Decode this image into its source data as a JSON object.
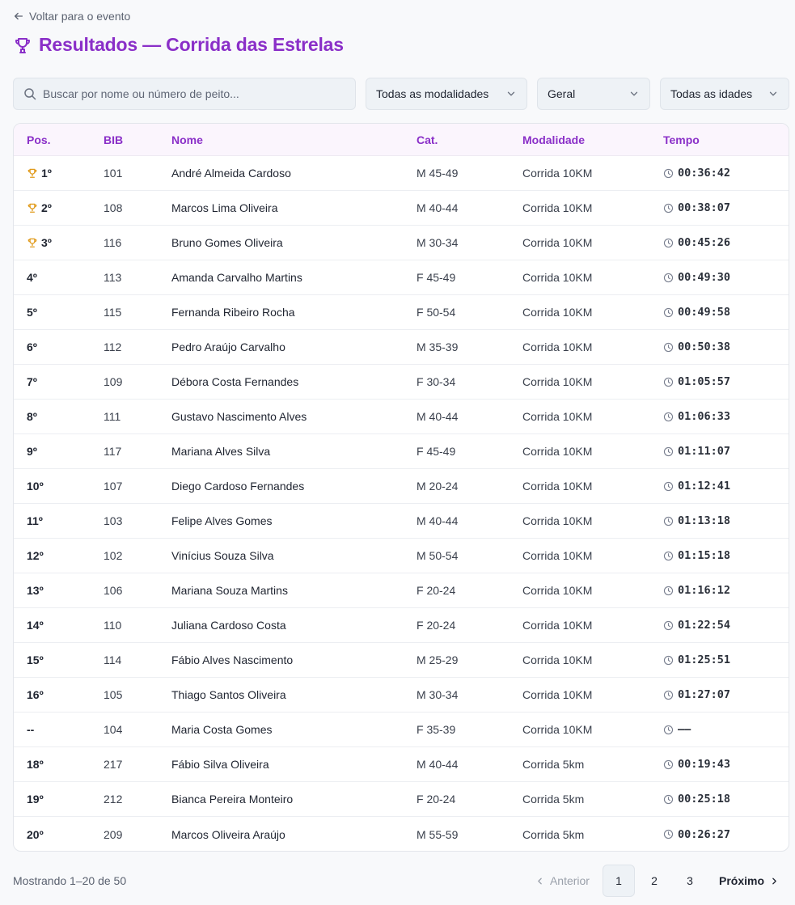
{
  "back_link": "Voltar para o evento",
  "title": "Resultados — Corrida das Estrelas",
  "accent_color": "#8a2fc8",
  "trophy_color": "#e09a1a",
  "search": {
    "placeholder": "Buscar por nome ou número de peito..."
  },
  "filters": {
    "modality": "Todas as modalidades",
    "gender": "Geral",
    "age": "Todas as idades"
  },
  "table": {
    "headers": {
      "pos": "Pos.",
      "bib": "BIB",
      "name": "Nome",
      "cat": "Cat.",
      "mod": "Modalidade",
      "time": "Tempo"
    },
    "rows": [
      {
        "pos": "1º",
        "trophy": true,
        "bib": "101",
        "name": "André Almeida Cardoso",
        "cat": "M 45-49",
        "mod": "Corrida 10KM",
        "time": "00:36:42"
      },
      {
        "pos": "2º",
        "trophy": true,
        "bib": "108",
        "name": "Marcos Lima Oliveira",
        "cat": "M 40-44",
        "mod": "Corrida 10KM",
        "time": "00:38:07"
      },
      {
        "pos": "3º",
        "trophy": true,
        "bib": "116",
        "name": "Bruno Gomes Oliveira",
        "cat": "M 30-34",
        "mod": "Corrida 10KM",
        "time": "00:45:26"
      },
      {
        "pos": "4º",
        "trophy": false,
        "bib": "113",
        "name": "Amanda Carvalho Martins",
        "cat": "F 45-49",
        "mod": "Corrida 10KM",
        "time": "00:49:30"
      },
      {
        "pos": "5º",
        "trophy": false,
        "bib": "115",
        "name": "Fernanda Ribeiro Rocha",
        "cat": "F 50-54",
        "mod": "Corrida 10KM",
        "time": "00:49:58"
      },
      {
        "pos": "6º",
        "trophy": false,
        "bib": "112",
        "name": "Pedro Araújo Carvalho",
        "cat": "M 35-39",
        "mod": "Corrida 10KM",
        "time": "00:50:38"
      },
      {
        "pos": "7º",
        "trophy": false,
        "bib": "109",
        "name": "Débora Costa Fernandes",
        "cat": "F 30-34",
        "mod": "Corrida 10KM",
        "time": "01:05:57"
      },
      {
        "pos": "8º",
        "trophy": false,
        "bib": "111",
        "name": "Gustavo Nascimento Alves",
        "cat": "M 40-44",
        "mod": "Corrida 10KM",
        "time": "01:06:33"
      },
      {
        "pos": "9º",
        "trophy": false,
        "bib": "117",
        "name": "Mariana Alves Silva",
        "cat": "F 45-49",
        "mod": "Corrida 10KM",
        "time": "01:11:07"
      },
      {
        "pos": "10º",
        "trophy": false,
        "bib": "107",
        "name": "Diego Cardoso Fernandes",
        "cat": "M 20-24",
        "mod": "Corrida 10KM",
        "time": "01:12:41"
      },
      {
        "pos": "11º",
        "trophy": false,
        "bib": "103",
        "name": "Felipe Alves Gomes",
        "cat": "M 40-44",
        "mod": "Corrida 10KM",
        "time": "01:13:18"
      },
      {
        "pos": "12º",
        "trophy": false,
        "bib": "102",
        "name": "Vinícius Souza Silva",
        "cat": "M 50-54",
        "mod": "Corrida 10KM",
        "time": "01:15:18"
      },
      {
        "pos": "13º",
        "trophy": false,
        "bib": "106",
        "name": "Mariana Souza Martins",
        "cat": "F 20-24",
        "mod": "Corrida 10KM",
        "time": "01:16:12"
      },
      {
        "pos": "14º",
        "trophy": false,
        "bib": "110",
        "name": "Juliana Cardoso Costa",
        "cat": "F 20-24",
        "mod": "Corrida 10KM",
        "time": "01:22:54"
      },
      {
        "pos": "15º",
        "trophy": false,
        "bib": "114",
        "name": "Fábio Alves Nascimento",
        "cat": "M 25-29",
        "mod": "Corrida 10KM",
        "time": "01:25:51"
      },
      {
        "pos": "16º",
        "trophy": false,
        "bib": "105",
        "name": "Thiago Santos Oliveira",
        "cat": "M 30-34",
        "mod": "Corrida 10KM",
        "time": "01:27:07"
      },
      {
        "pos": "--",
        "trophy": false,
        "bib": "104",
        "name": "Maria Costa Gomes",
        "cat": "F 35-39",
        "mod": "Corrida 10KM",
        "time": "——"
      },
      {
        "pos": "18º",
        "trophy": false,
        "bib": "217",
        "name": "Fábio Silva Oliveira",
        "cat": "M 40-44",
        "mod": "Corrida 5km",
        "time": "00:19:43"
      },
      {
        "pos": "19º",
        "trophy": false,
        "bib": "212",
        "name": "Bianca Pereira Monteiro",
        "cat": "F 20-24",
        "mod": "Corrida 5km",
        "time": "00:25:18"
      },
      {
        "pos": "20º",
        "trophy": false,
        "bib": "209",
        "name": "Marcos Oliveira Araújo",
        "cat": "M 55-59",
        "mod": "Corrida 5km",
        "time": "00:26:27"
      }
    ]
  },
  "footer": {
    "showing": "Mostrando 1–20 de 50"
  },
  "pagination": {
    "prev": "Anterior",
    "pages": [
      "1",
      "2",
      "3"
    ],
    "current": "1",
    "next": "Próximo"
  }
}
